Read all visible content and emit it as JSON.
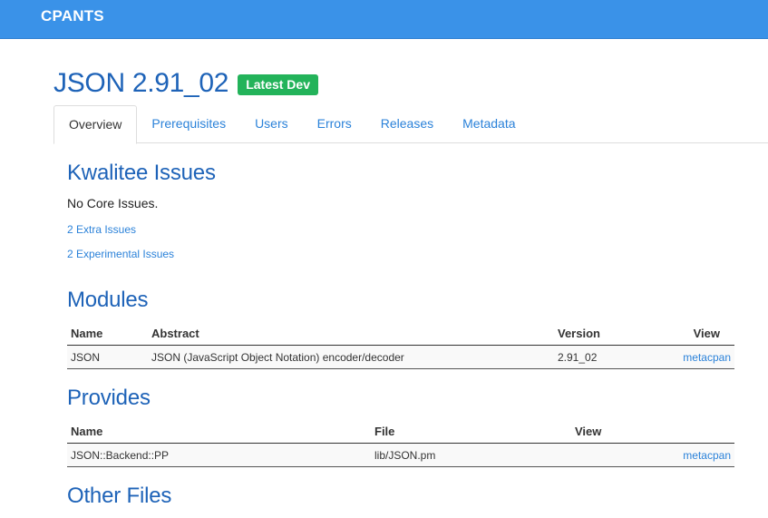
{
  "navbar": {
    "brand": "CPANTS"
  },
  "header": {
    "title": "JSON 2.91_02",
    "badge": "Latest Dev"
  },
  "tabs": [
    {
      "label": "Overview",
      "active": true
    },
    {
      "label": "Prerequisites"
    },
    {
      "label": "Users"
    },
    {
      "label": "Errors"
    },
    {
      "label": "Releases"
    },
    {
      "label": "Metadata"
    }
  ],
  "kwalitee": {
    "heading": "Kwalitee Issues",
    "core_text": "No Core Issues.",
    "extra_link": "2 Extra Issues",
    "experimental_link": "2 Experimental Issues"
  },
  "modules": {
    "heading": "Modules",
    "columns": [
      "Name",
      "Abstract",
      "Version",
      "View"
    ],
    "rows": [
      {
        "name": "JSON",
        "abstract": "JSON (JavaScript Object Notation) encoder/decoder",
        "version": "2.91_02",
        "view": "metacpan"
      }
    ]
  },
  "provides": {
    "heading": "Provides",
    "columns": [
      "Name",
      "File",
      "View"
    ],
    "rows": [
      {
        "name": "JSON::Backend::PP",
        "file": "lib/JSON.pm",
        "view": "metacpan"
      }
    ]
  },
  "other_files": {
    "heading": "Other Files"
  },
  "colors": {
    "navbar": "#3a92e8",
    "heading": "#1e63b8",
    "link": "#2b82d9",
    "badge": "#23b35a"
  }
}
